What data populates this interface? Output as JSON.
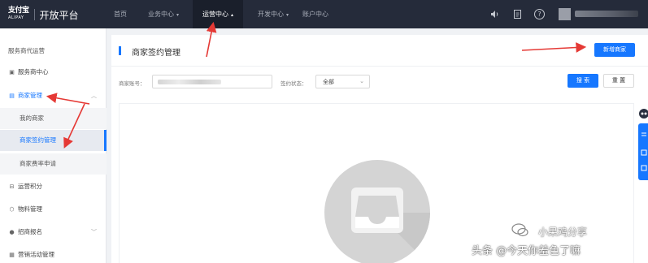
{
  "brand": {
    "mark": "支付宝",
    "mark_sub": "ALIPAY",
    "name": "开放平台"
  },
  "topnav": {
    "items": [
      {
        "label": "首页",
        "caret": ""
      },
      {
        "label": "业务中心",
        "caret": "▾"
      },
      {
        "label": "运营中心",
        "caret": "▴"
      },
      {
        "label": "开发中心",
        "caret": "▾"
      },
      {
        "label": "账户中心",
        "caret": ""
      }
    ],
    "active_index": 2,
    "icons": [
      "speaker-icon",
      "document-icon",
      "help-icon"
    ]
  },
  "sidebar": {
    "header": "服务商代运营",
    "items": [
      {
        "label": "服务商中心",
        "icon": "grid-icon"
      },
      {
        "label": "商家管理",
        "icon": "store-icon",
        "open": true
      },
      {
        "label": "我的商家"
      },
      {
        "label": "商家签约管理",
        "active": true
      },
      {
        "label": "商家费率申请"
      },
      {
        "label": "运营积分",
        "icon": "points-icon"
      },
      {
        "label": "物料管理",
        "icon": "box-icon"
      },
      {
        "label": "招商报名",
        "icon": "user-icon"
      },
      {
        "label": "营销活动管理",
        "icon": "marketing-icon"
      }
    ]
  },
  "main": {
    "title": "商家签约管理",
    "new_merchant_button": "新增商家",
    "filters": {
      "account_label": "商家账号：",
      "status_label": "签约状态：",
      "status_value": "全部"
    },
    "search_button": "搜 索",
    "reset_button": "重 置"
  },
  "watermark": {
    "line1": "小呆鸡分享",
    "line2": "头条 @今天你羞色了嘛"
  },
  "colors": {
    "accent": "#1677ff",
    "topbar": "#252b3a",
    "arrow": "#e53935"
  }
}
